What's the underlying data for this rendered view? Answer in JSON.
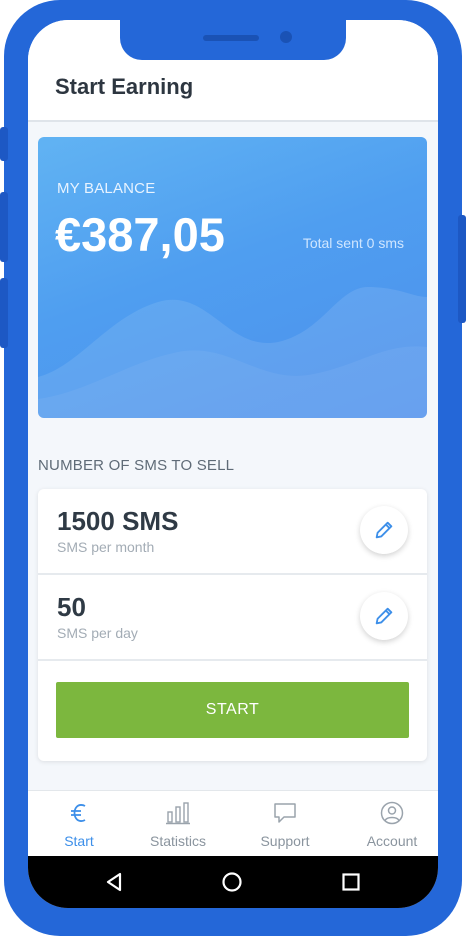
{
  "header": {
    "title": "Start Earning"
  },
  "balance": {
    "label": "MY BALANCE",
    "amount": "€387,05",
    "total_sent": "Total sent 0 sms"
  },
  "sms_section": {
    "title": "NUMBER OF SMS TO SELL",
    "rows": [
      {
        "value": "1500 SMS",
        "caption": "SMS per month",
        "icon": "pencil-icon"
      },
      {
        "value": "50",
        "caption": "SMS per day",
        "icon": "pencil-icon"
      }
    ],
    "start_label": "START"
  },
  "nav": {
    "items": [
      {
        "label": "Start",
        "icon": "euro-icon",
        "active": true
      },
      {
        "label": "Statistics",
        "icon": "bar-chart-icon",
        "active": false
      },
      {
        "label": "Support",
        "icon": "chat-icon",
        "active": false
      },
      {
        "label": "Account",
        "icon": "user-icon",
        "active": false
      }
    ]
  },
  "system_nav": {
    "icons": [
      "back-triangle-icon",
      "home-circle-icon",
      "recent-square-icon"
    ]
  },
  "colors": {
    "frame": "#2467d8",
    "balance_card": "#4f9ef0",
    "start_button": "#7cb73e",
    "active_nav": "#3d8fe9"
  }
}
